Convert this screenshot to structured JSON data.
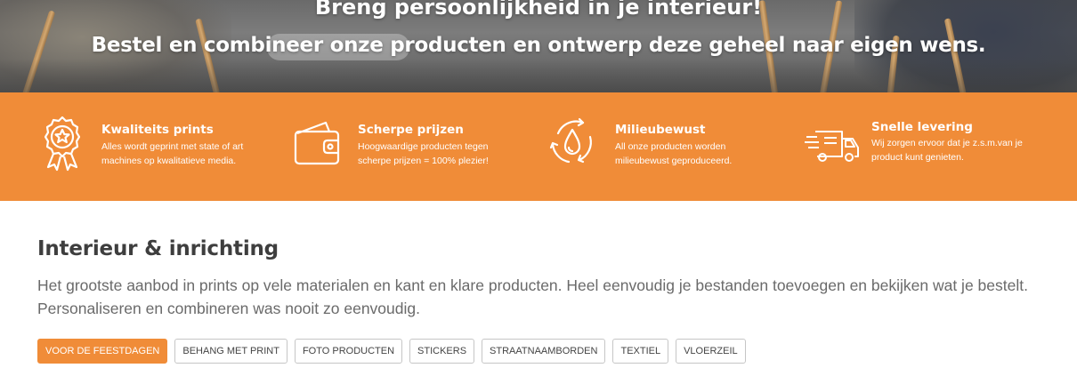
{
  "hero": {
    "line1": "Breng persoonlijkheid in je interieur!",
    "line2": "Bestel en combineer onze producten en ontwerp deze geheel naar eigen wens."
  },
  "features": [
    {
      "icon": "award-icon",
      "title": "Kwaliteits prints",
      "desc": "Alles wordt geprint met state of art machines op kwalitatieve media."
    },
    {
      "icon": "wallet-icon",
      "title": "Scherpe prijzen",
      "desc": "Hoogwaardige producten tegen scherpe prijzen = 100% plezier!"
    },
    {
      "icon": "eco-drop-icon",
      "title": "Milieubewust",
      "desc": "All onze producten worden milieubewust geproduceerd."
    },
    {
      "icon": "delivery-truck-icon",
      "title": "Snelle levering",
      "desc": "Wij zorgen ervoor dat je z.s.m.van je product kunt genieten."
    }
  ],
  "section": {
    "title": "Interieur & inrichting",
    "desc": "Het grootste aanbod in prints op vele materialen en kant en klare producten. Heel eenvoudig je bestanden toevoegen en bekijken wat je bestelt. Personaliseren en combineren was nooit zo eenvoudig."
  },
  "tags": [
    {
      "label": "Voor de feestdagen",
      "active": true
    },
    {
      "label": "Behang met print",
      "active": false
    },
    {
      "label": "Foto producten",
      "active": false
    },
    {
      "label": "Stickers",
      "active": false
    },
    {
      "label": "Straatnaamborden",
      "active": false
    },
    {
      "label": "Textiel",
      "active": false
    },
    {
      "label": "Vloerzeil",
      "active": false
    }
  ],
  "colors": {
    "accent": "#f08c38",
    "text": "#3e3e3e",
    "muted": "#6a6a6a"
  }
}
